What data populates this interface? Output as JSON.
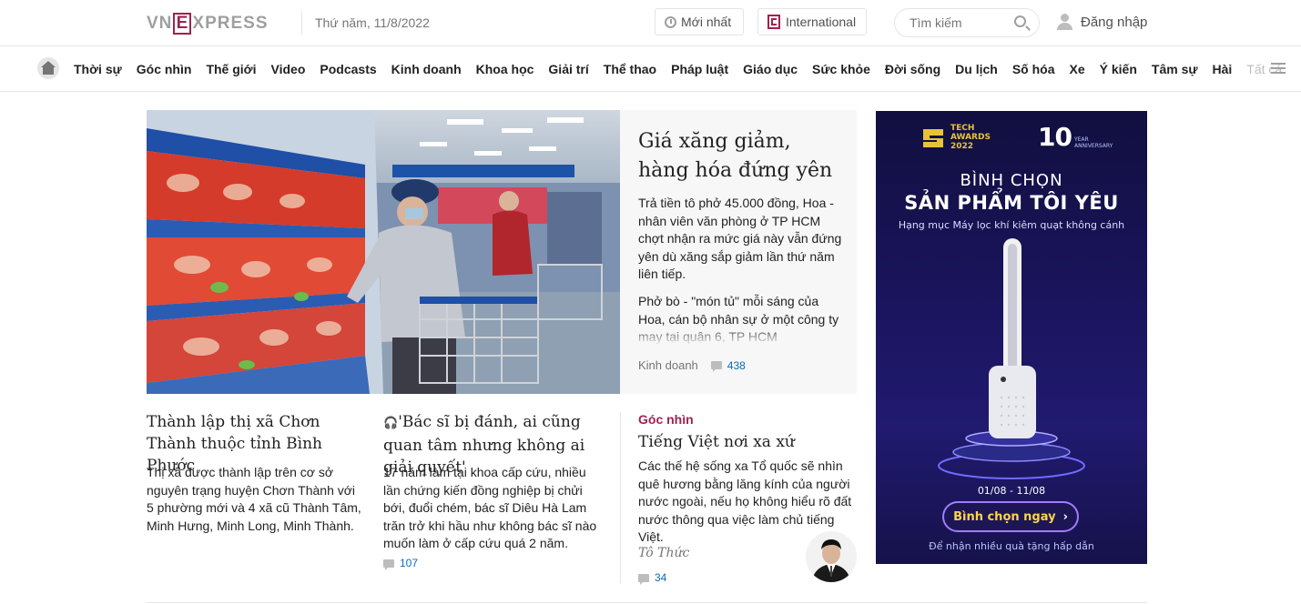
{
  "header": {
    "logo_text": "VNEXPRESS",
    "date": "Thứ năm, 11/8/2022",
    "latest_label": "Mới nhất",
    "international_label": "International",
    "search_placeholder": "Tìm kiếm",
    "login_label": "Đăng nhập"
  },
  "nav": {
    "items": [
      "Thời sự",
      "Góc nhìn",
      "Thế giới",
      "Video",
      "Podcasts",
      "Kinh doanh",
      "Khoa học",
      "Giải trí",
      "Thể thao",
      "Pháp luật",
      "Giáo dục",
      "Sức khỏe",
      "Đời sống",
      "Du lịch",
      "Số hóa",
      "Xe",
      "Ý kiến",
      "Tâm sự",
      "Hài",
      "Tất cả"
    ]
  },
  "featured": {
    "title": "Giá xăng giảm, hàng hóa đứng yên",
    "desc1": "Trả tiền tô phở 45.000 đồng, Hoa - nhân viên văn phòng ở TP HCM chợt nhận ra mức giá này vẫn đứng yên dù xăng sắp giảm lần thứ năm liên tiếp.",
    "desc2": "Phở bò - \"món tủ\" mỗi sáng của Hoa, cán bộ nhân sự ở một công ty may tại quận 6, TP HCM",
    "category": "Kinh doanh",
    "comments": "438"
  },
  "articles": [
    {
      "title": "Thành lập thị xã Chơn Thành thuộc tỉnh Bình Phước",
      "desc": "Thị xã được thành lập trên cơ sở nguyên trạng huyện Chơn Thành với 5 phường mới và 4 xã cũ Thành Tâm, Minh Hưng, Minh Long, Minh Thành."
    },
    {
      "title": "'Bác sĩ bị đánh, ai cũng quan tâm nhưng không ai giải quyết'",
      "desc": "17 năm làm tại khoa cấp cứu, nhiều lần chứng kiến đồng nghiệp bị chửi bới, đuổi chém, bác sĩ Diêu Hà Lam trăn trở khi hầu như không bác sĩ nào muốn làm ở cấp cứu quá 2 năm.",
      "comments": "107"
    },
    {
      "category": "Góc nhìn",
      "title": "Tiếng Việt nơi xa xứ",
      "desc": "Các thế hệ sống xa Tổ quốc sẽ nhìn quê hương bằng lăng kính của người nước ngoài, nếu họ không hiểu rõ đất nước thông qua việc làm chủ tiếng Việt.",
      "author": "Tô Thức",
      "comments": "34"
    }
  ],
  "ad": {
    "brand_line1": "TECH",
    "brand_line2": "AWARDS",
    "brand_year": "2022",
    "anniv_num": "10",
    "anniv_text1": "YEAR",
    "anniv_text2": "ANNIVERSARY",
    "heading1": "BÌNH CHỌN",
    "heading2": "SẢN PHẨM TÔI YÊU",
    "subheading": "Hạng mục Máy lọc khí kiêm quạt không cánh",
    "dates": "01/08 - 11/08",
    "button": "Bình chọn ngay",
    "footer": "Để nhận nhiều quà tặng hấp dẫn"
  },
  "colors": {
    "brand": "#9f224e",
    "link_blue": "#076db6",
    "ad_bg": "#1b1560",
    "ad_button_text": "#ffd34d"
  }
}
